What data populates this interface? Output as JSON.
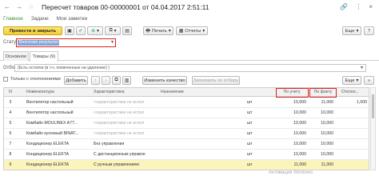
{
  "window": {
    "title": "Пересчет товаров 00-00000001 от 04.04.2017 2:51:11"
  },
  "nav_tabs": [
    "Главное",
    "Задачи",
    "Мои заметки"
  ],
  "toolbar": {
    "post_close": "Провести и закрыть",
    "print": "Печать",
    "reports": "Отчеты",
    "more": "Еще"
  },
  "status": {
    "label": "Статус:",
    "value": "Внесение результатов"
  },
  "page_tabs": [
    "Основное",
    "Товары (9)"
  ],
  "filter": {
    "label": "Отбор:",
    "value": "(Есть остатки (в т.ч. помеченные на удаление) )"
  },
  "table_tools": {
    "checkbox_label": "Только с отклонениями",
    "add": "Добавить",
    "change_quantity": "Изменить качество",
    "fill_by_selection": "Заполнить по отбору",
    "more": "Еще"
  },
  "table": {
    "headers": [
      "N",
      "Номенклатура",
      "Характеристика",
      "Назначение",
      "",
      "По учету",
      "По факту",
      "Отклон..."
    ],
    "rows": [
      {
        "n": "3",
        "name": "Вентилятор настольный",
        "char": "<характеристики не испол",
        "unit": "шт",
        "book": "10,000",
        "fact": "11,000",
        "dev": "1,000"
      },
      {
        "n": "4",
        "name": "Вентилятор настольный",
        "char": "<характеристики не испол",
        "unit": "шт",
        "book": "10,000",
        "fact": "10,000",
        "dev": ""
      },
      {
        "n": "5",
        "name": "Комбайн MOULINEX A77...",
        "char": "<характеристики не испол",
        "unit": "шт",
        "book": "10,000",
        "fact": "10,000",
        "dev": ""
      },
      {
        "n": "6",
        "name": "Комбайн кухонный BINAT...",
        "char": "<характеристики не испол",
        "unit": "шт",
        "book": "10,000",
        "fact": "10,000",
        "dev": ""
      },
      {
        "n": "7",
        "name": "Кондиционер ELEKTA",
        "char": "Без управления",
        "unit": "шт",
        "book": "10,000",
        "fact": "10,000",
        "dev": ""
      },
      {
        "n": "8",
        "name": "Кондиционер ELEKTA",
        "char": "С дистанционным управле",
        "unit": "шт",
        "book": "10,000",
        "fact": "10,000",
        "dev": ""
      },
      {
        "n": "9",
        "name": "Кондиционер ELEKTA",
        "char": "С ручным управлением",
        "unit": "шт",
        "book": "11,000",
        "fact": "11,000",
        "dev": ""
      }
    ]
  },
  "watermark": "Активация Windows",
  "colors": {
    "accent_green": "#4a8a3c",
    "highlight_red": "#dd2222",
    "primary_yellow": "#f5cf2e",
    "selected_row": "#fbf4bd"
  }
}
